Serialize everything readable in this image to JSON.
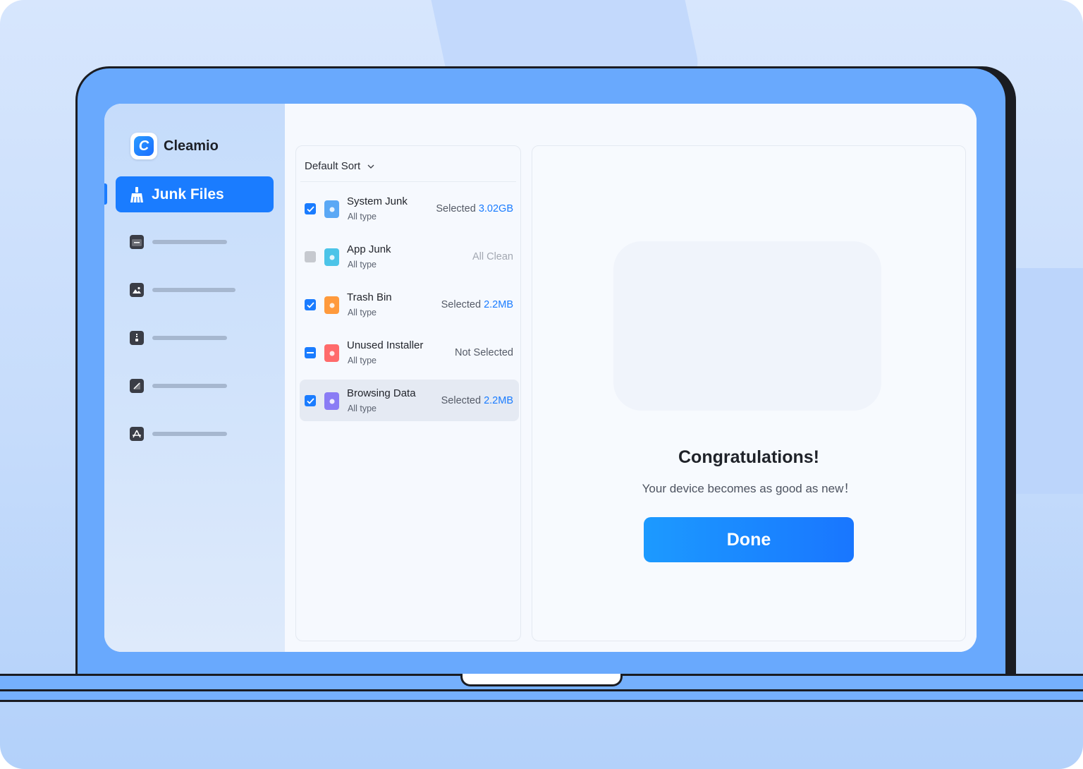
{
  "app": {
    "name": "Cleamio"
  },
  "sidebar": {
    "active_item": {
      "label": "Junk Files",
      "icon": "broom-icon"
    },
    "items": [
      {
        "icon": "folder-icon"
      },
      {
        "icon": "photo-icon"
      },
      {
        "icon": "zip-archive-icon"
      },
      {
        "icon": "document-icon"
      },
      {
        "icon": "app-store-icon"
      }
    ]
  },
  "list": {
    "sort_label": "Default Sort",
    "rows": [
      {
        "name": "System Junk",
        "type": "All type",
        "status_prefix": "Selected",
        "status_value": "3.02GB",
        "status_text": "",
        "checkbox": "checked",
        "icon": "system-junk-icon",
        "icon_color": "#5aa8f5"
      },
      {
        "name": "App Junk",
        "type": "All type",
        "status_prefix": "",
        "status_value": "",
        "status_text": "All Clean",
        "checkbox": "disabled",
        "icon": "app-junk-icon",
        "icon_color": "#4cc4e8"
      },
      {
        "name": "Trash Bin",
        "type": "All type",
        "status_prefix": "Selected",
        "status_value": "2.2MB",
        "status_text": "",
        "checkbox": "checked",
        "icon": "trash-bin-icon",
        "icon_color": "#ff9a3c"
      },
      {
        "name": "Unused Installer",
        "type": "All type",
        "status_prefix": "",
        "status_value": "",
        "status_text": "Not Selected",
        "checkbox": "partial",
        "icon": "installer-icon",
        "icon_color": "#ff6b6b"
      },
      {
        "name": "Browsing Data",
        "type": "All type",
        "status_prefix": "Selected",
        "status_value": "2.2MB",
        "status_text": "",
        "checkbox": "checked",
        "icon": "browsing-data-icon",
        "icon_color": "#8a7cf5"
      }
    ]
  },
  "result": {
    "title": "Congratulations!",
    "subtitle": "Your device becomes as good as new！",
    "done_label": "Done"
  },
  "colors": {
    "accent": "#1a7cff",
    "background": "#d7e6fd"
  }
}
